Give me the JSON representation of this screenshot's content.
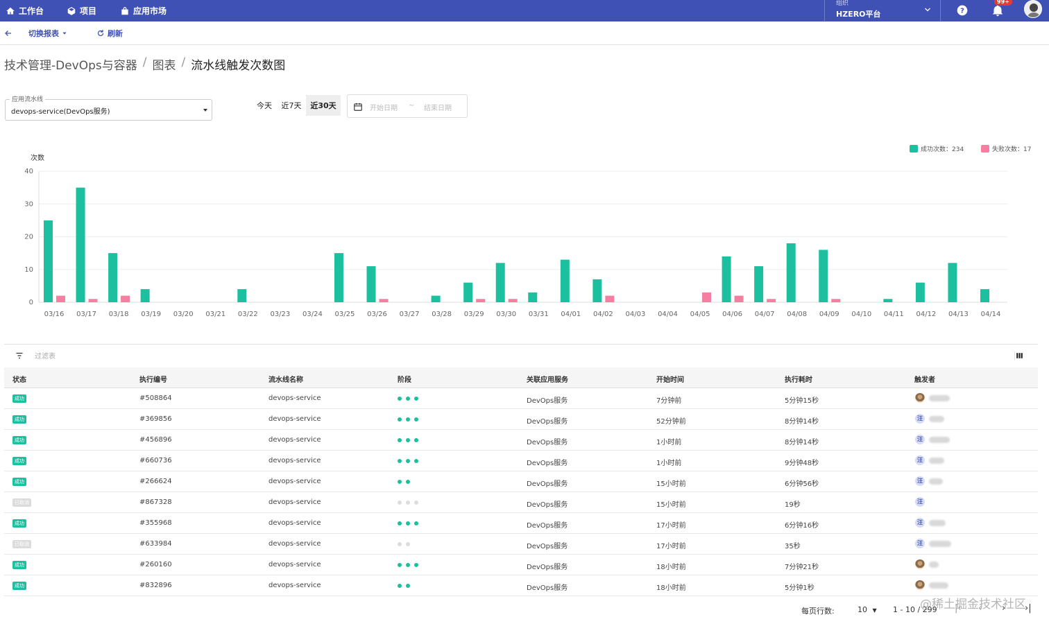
{
  "topbar": {
    "nav": [
      {
        "label": "工作台",
        "icon": "home-icon"
      },
      {
        "label": "项目",
        "icon": "cube-icon"
      },
      {
        "label": "应用市场",
        "icon": "store-icon"
      }
    ],
    "org_label": "组织",
    "org_name": "HZERO平台",
    "notification_count": "99+"
  },
  "toolbar": {
    "switch_label": "切换报表",
    "refresh_label": "刷新"
  },
  "breadcrumb": [
    "技术管理-DevOps与容器",
    "图表",
    "流水线触发次数图"
  ],
  "filters": {
    "pipeline_label": "应用流水线",
    "pipeline_value": "devops-service(DevOps服务)",
    "ranges": [
      "今天",
      "近7天",
      "近30天"
    ],
    "active_range": "近30天",
    "date_start_placeholder": "开始日期",
    "date_tilde": "~",
    "date_end_placeholder": "结束日期"
  },
  "legend": {
    "success": "成功次数：234",
    "fail": "失败次数：17"
  },
  "colors": {
    "success": "#1cbf9e",
    "fail": "#f47fa0",
    "primary": "#3f51b5"
  },
  "chart_data": {
    "type": "bar",
    "ylabel": "次数",
    "ylim": [
      0,
      40
    ],
    "yticks": [
      0,
      10,
      20,
      30,
      40
    ],
    "categories": [
      "03/16",
      "03/17",
      "03/18",
      "03/19",
      "03/20",
      "03/21",
      "03/22",
      "03/23",
      "03/24",
      "03/25",
      "03/26",
      "03/27",
      "03/28",
      "03/29",
      "03/30",
      "03/31",
      "04/01",
      "04/02",
      "04/03",
      "04/04",
      "04/05",
      "04/06",
      "04/07",
      "04/08",
      "04/09",
      "04/10",
      "04/11",
      "04/12",
      "04/13",
      "04/14"
    ],
    "series": [
      {
        "name": "成功次数",
        "values": [
          25,
          35,
          15,
          4,
          0,
          0,
          4,
          0,
          0,
          15,
          11,
          0,
          2,
          6,
          12,
          3,
          13,
          7,
          0,
          0,
          0,
          14,
          11,
          18,
          16,
          0,
          1,
          6,
          12,
          4
        ]
      },
      {
        "name": "失败次数",
        "values": [
          2,
          1,
          2,
          0,
          0,
          0,
          0,
          0,
          0,
          0,
          1,
          0,
          0,
          1,
          1,
          0,
          0,
          2,
          0,
          0,
          3,
          2,
          1,
          0,
          1,
          0,
          0,
          0,
          0,
          0
        ]
      }
    ],
    "grid": true,
    "legend_position": "top-right"
  },
  "table": {
    "filter_placeholder": "过滤表",
    "headers": [
      "状态",
      "执行编号",
      "流水线名称",
      "阶段",
      "关联应用服务",
      "开始时间",
      "执行耗时",
      "触发者"
    ],
    "rows": [
      {
        "status": "成功",
        "status_type": "success",
        "id": "#508864",
        "pipeline": "devops-service",
        "stages": [
          1,
          1,
          1
        ],
        "service": "DevOps服务",
        "start": "7分钟前",
        "duration": "5分钟15秒",
        "avatar": "img",
        "avatar_text": ""
      },
      {
        "status": "成功",
        "status_type": "success",
        "id": "#369856",
        "pipeline": "devops-service",
        "stages": [
          1,
          1,
          1
        ],
        "service": "DevOps服务",
        "start": "52分钟前",
        "duration": "8分钟14秒",
        "avatar": "txt",
        "avatar_text": "汪"
      },
      {
        "status": "成功",
        "status_type": "success",
        "id": "#456896",
        "pipeline": "devops-service",
        "stages": [
          1,
          1,
          1
        ],
        "service": "DevOps服务",
        "start": "1小时前",
        "duration": "8分钟14秒",
        "avatar": "txt",
        "avatar_text": "汪"
      },
      {
        "status": "成功",
        "status_type": "success",
        "id": "#660736",
        "pipeline": "devops-service",
        "stages": [
          1,
          1,
          1
        ],
        "service": "DevOps服务",
        "start": "1小时前",
        "duration": "9分钟48秒",
        "avatar": "txt",
        "avatar_text": "汪"
      },
      {
        "status": "成功",
        "status_type": "success",
        "id": "#266624",
        "pipeline": "devops-service",
        "stages": [
          1,
          1
        ],
        "service": "DevOps服务",
        "start": "15小时前",
        "duration": "6分钟56秒",
        "avatar": "txt",
        "avatar_text": "汪"
      },
      {
        "status": "已取消",
        "status_type": "cancel",
        "id": "#867328",
        "pipeline": "devops-service",
        "stages": [
          0,
          0,
          0
        ],
        "service": "DevOps服务",
        "start": "15小时前",
        "duration": "19秒",
        "avatar": "txt",
        "avatar_text": "汪"
      },
      {
        "status": "成功",
        "status_type": "success",
        "id": "#355968",
        "pipeline": "devops-service",
        "stages": [
          1,
          1,
          1
        ],
        "service": "DevOps服务",
        "start": "17小时前",
        "duration": "6分钟16秒",
        "avatar": "txt",
        "avatar_text": "汪"
      },
      {
        "status": "已取消",
        "status_type": "cancel",
        "id": "#633984",
        "pipeline": "devops-service",
        "stages": [
          0,
          0
        ],
        "service": "DevOps服务",
        "start": "17小时前",
        "duration": "35秒",
        "avatar": "txt",
        "avatar_text": "汪"
      },
      {
        "status": "成功",
        "status_type": "success",
        "id": "#260160",
        "pipeline": "devops-service",
        "stages": [
          1,
          1,
          1
        ],
        "service": "DevOps服务",
        "start": "18小时前",
        "duration": "7分钟21秒",
        "avatar": "img",
        "avatar_text": ""
      },
      {
        "status": "成功",
        "status_type": "success",
        "id": "#832896",
        "pipeline": "devops-service",
        "stages": [
          1,
          1
        ],
        "service": "DevOps服务",
        "start": "18小时前",
        "duration": "5分钟1秒",
        "avatar": "img",
        "avatar_text": ""
      }
    ]
  },
  "pagination": {
    "rows_per_page_label": "每页行数:",
    "rows_per_page": "10",
    "range": "1 - 10 / 299"
  },
  "watermark": "@稀土掘金技术社区"
}
